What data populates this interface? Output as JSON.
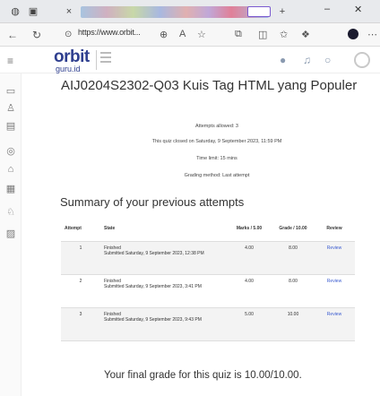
{
  "browser": {
    "url": "https://www.orbit...",
    "tab_close": "×",
    "new_tab": "+"
  },
  "site": {
    "logo_text": "orbit",
    "logo_sub": "guru.id"
  },
  "quiz": {
    "title": "AIJ0204S2302-Q03 Kuis Tag HTML yang Populer",
    "attempts_allowed": "Attempts allowed: 3",
    "closed_on": "This quiz closed on Saturday, 9 September 2023, 11:59 PM",
    "time_limit": "Time limit: 15 mins",
    "grading_method": "Grading method: Last attempt"
  },
  "summary": {
    "title": "Summary of your previous attempts",
    "headers": {
      "attempt": "Attempt",
      "state": "State",
      "marks": "Marks / 5.00",
      "grade": "Grade / 10.00",
      "review": "Review"
    },
    "rows": [
      {
        "attempt": "1",
        "status": "Finished",
        "submitted": "Submitted Saturday, 9 September 2023, 12:38 PM",
        "marks": "4.00",
        "grade": "8.00",
        "review": "Review"
      },
      {
        "attempt": "2",
        "status": "Finished",
        "submitted": "Submitted Saturday, 9 September 2023, 3:41 PM",
        "marks": "4.00",
        "grade": "8.00",
        "review": "Review"
      },
      {
        "attempt": "3",
        "status": "Finished",
        "submitted": "Submitted Saturday, 9 September 2023, 9:43 PM",
        "marks": "5.00",
        "grade": "10.00",
        "review": "Review"
      }
    ]
  },
  "final_grade": "Your final grade for this quiz is 10.00/10.00."
}
